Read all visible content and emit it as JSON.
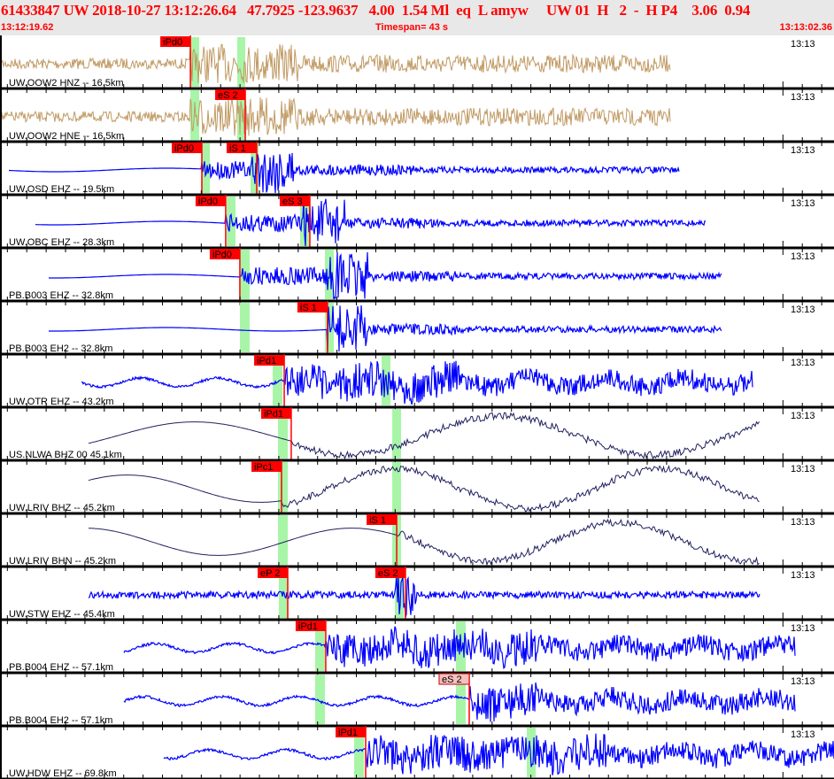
{
  "header": {
    "event_line": "61433847 UW 2018-10-27 13:12:26.64   47.7925 -123.9637   4.00  1.54 Ml  eq  L amyw     UW 01  H   2  -  H P4    3.06  0.94",
    "start_time": "13:12:19.62",
    "timespan": "Timespan=  43 s",
    "end_time": "13:13:02.36"
  },
  "colors": {
    "header_text": "#ff0000",
    "accel": "#c09a64",
    "short_period": "#0000ff",
    "broadband": "#202060",
    "pick": "#ff0000",
    "pick_unsure": "#f4c0c0",
    "window": "#a8f5a8"
  },
  "traces": [
    {
      "label": "UW.OOW2 HNZ -- 16.5km",
      "time": "13:13",
      "kind": "accel",
      "picks": [
        {
          "label": "iPd0",
          "time": "13:12:29.44"
        }
      ]
    },
    {
      "label": "UW.OOW2 HNE -- 16.5km",
      "time": "13:13",
      "kind": "accel",
      "picks": [
        {
          "label": "eS 2",
          "time": "13:12:32.27"
        }
      ]
    },
    {
      "label": "UW.OSD EHZ -- 19.5km",
      "time": "13:13",
      "kind": "short_period",
      "picks": [
        {
          "label": "iPd0",
          "time": "13:12:30.03"
        },
        {
          "label": "iS 1",
          "time": "13:12:32.86"
        }
      ]
    },
    {
      "label": "UW.OBC EHZ -- 28.3km",
      "time": "13:13",
      "kind": "short_period",
      "picks": [
        {
          "label": "iPd0",
          "time": "13:12:31.26"
        },
        {
          "label": "eS 3",
          "time": "13:12:35.60"
        }
      ]
    },
    {
      "label": "PB.B003 EHZ -- 32.8km",
      "time": "13:13",
      "kind": "short_period",
      "picks": [
        {
          "label": "iPd0",
          "time": "13:12:31.99"
        }
      ]
    },
    {
      "label": "PB.B003 EH2 -- 32.8km",
      "time": "13:13",
      "kind": "short_period",
      "picks": [
        {
          "label": "iS 1",
          "time": "13:12:36.51"
        }
      ]
    },
    {
      "label": "UW.OTR EHZ -- 43.2km",
      "time": "13:13",
      "kind": "short_period",
      "picks": [
        {
          "label": "iPd1",
          "time": "13:12:34.28"
        }
      ]
    },
    {
      "label": "US.NLWA BHZ 00 45.1km",
      "time": "13:13",
      "kind": "broadband",
      "picks": [
        {
          "label": "iPd1",
          "time": "13:12:34.64"
        }
      ]
    },
    {
      "label": "UW.LRIV BHZ -- 45.2km",
      "time": "13:13",
      "kind": "broadband",
      "picks": [
        {
          "label": "iPc1",
          "time": "13:12:34.14"
        }
      ]
    },
    {
      "label": "UW.LRIV BHN -- 45.2km",
      "time": "13:13",
      "kind": "broadband",
      "picks": [
        {
          "label": "iS 1",
          "time": "13:12:40.08"
        }
      ]
    },
    {
      "label": "UW.STW EHZ -- 45.4km",
      "time": "13:13",
      "kind": "short_period",
      "picks": [
        {
          "label": "eP 2",
          "time": "13:12:34.46"
        },
        {
          "label": "eS 2",
          "time": "13:12:40.53"
        }
      ]
    },
    {
      "label": "PB.B004 EHZ -- 57.1km",
      "time": "13:13",
      "kind": "short_period",
      "picks": [
        {
          "label": "iPd1",
          "time": "13:12:36.42"
        }
      ]
    },
    {
      "label": "PB.B004 EH2 -- 57.1km",
      "time": "13:13",
      "kind": "short_period",
      "picks": [
        {
          "label": "eS 2",
          "time": "13:12:43.82",
          "unsure": true
        }
      ]
    },
    {
      "label": "UW.HDW EHZ -- 69.8km",
      "time": "13:13",
      "kind": "short_period",
      "picks": [
        {
          "label": "iPd1",
          "time": "13:12:38.48"
        }
      ]
    }
  ]
}
